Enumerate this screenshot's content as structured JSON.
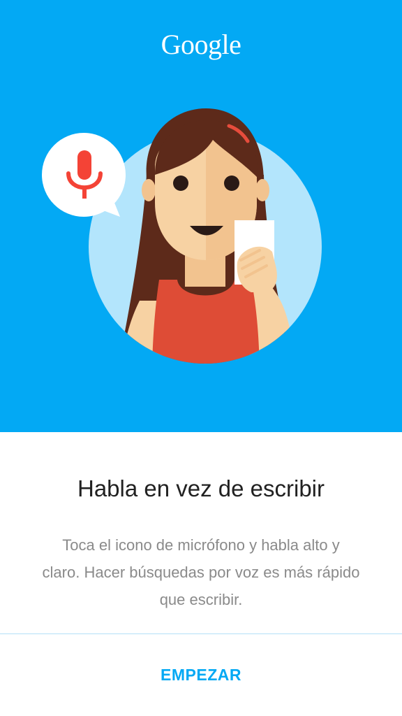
{
  "header": {
    "logo_text": "Google"
  },
  "illustration": {
    "icon": "microphone-icon",
    "mic_color": "#f44336",
    "background_color": "#03a9f4"
  },
  "onboarding": {
    "title": "Habla en vez de escribir",
    "description": "Toca el icono de micrófono y habla alto y claro. Hacer búsquedas por voz es más rápido que escribir."
  },
  "footer": {
    "start_label": "EMPEZAR",
    "accent_color": "#03a9f4"
  }
}
